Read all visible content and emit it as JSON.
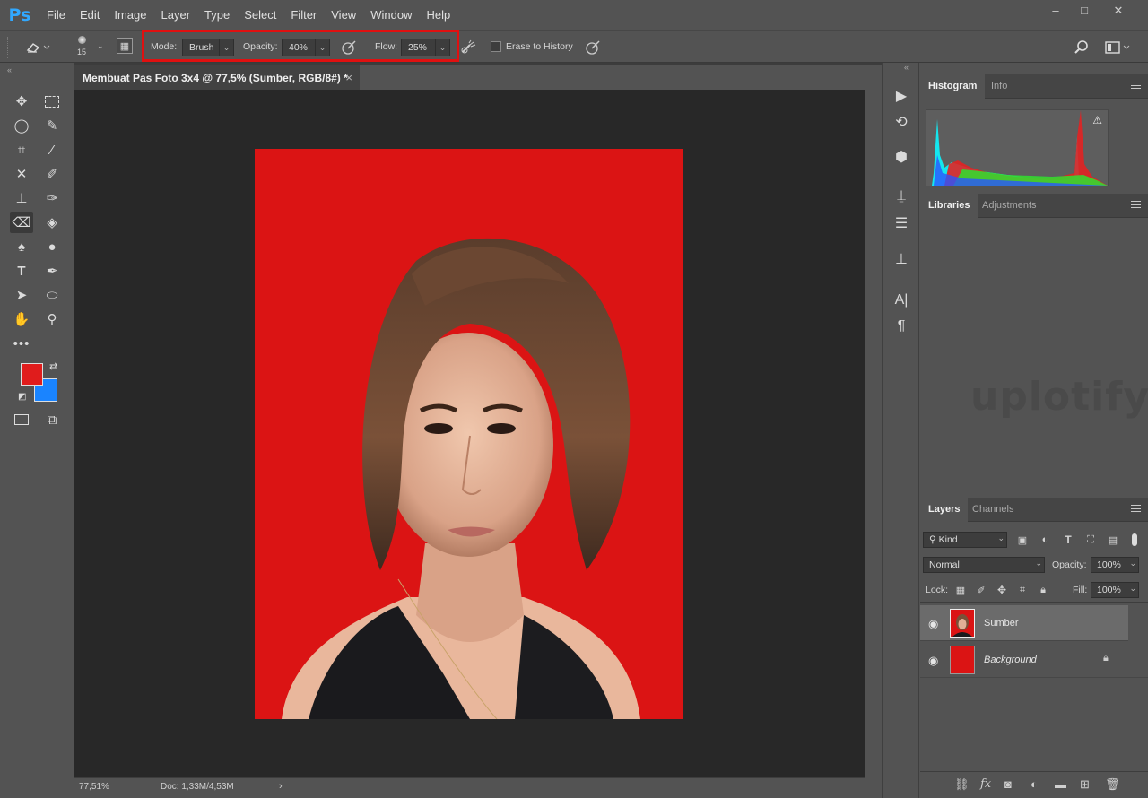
{
  "app": {
    "logo": "Ps"
  },
  "menu": [
    "File",
    "Edit",
    "Image",
    "Layer",
    "Type",
    "Select",
    "Filter",
    "View",
    "Window",
    "Help"
  ],
  "window_controls": {
    "minimize": "–",
    "restore": "□",
    "close": "✕"
  },
  "options": {
    "brush_size": "15",
    "mode_label": "Mode:",
    "mode_value": "Brush",
    "opacity_label": "Opacity:",
    "opacity_value": "40%",
    "flow_label": "Flow:",
    "flow_value": "25%",
    "erase_history_label": "Erase to History",
    "highlight_color": "#e01010"
  },
  "document": {
    "tab_title": "Membuat Pas Foto 3x4 @ 77,5% (Sumber, RGB/8#) *",
    "close_glyph": "×",
    "zoom": "77,51%",
    "doc_size": "Doc: 1,33M/4,53M",
    "background_color": "#db1414"
  },
  "colors": {
    "foreground": "#e01c1c",
    "background": "#1a84ff"
  },
  "panels": {
    "histogram_tabs": [
      "Histogram",
      "Info"
    ],
    "libraries_tabs": [
      "Libraries",
      "Adjustments"
    ],
    "layers_tabs": [
      "Layers",
      "Channels"
    ],
    "watermark": "uplotify"
  },
  "layers": {
    "kind_label": "Kind",
    "blend_mode": "Normal",
    "opacity_label": "Opacity:",
    "opacity_value": "100%",
    "lock_label": "Lock:",
    "fill_label": "Fill:",
    "fill_value": "100%",
    "items": [
      {
        "name": "Sumber",
        "selected": true
      },
      {
        "name": "Background",
        "locked": true
      }
    ]
  }
}
